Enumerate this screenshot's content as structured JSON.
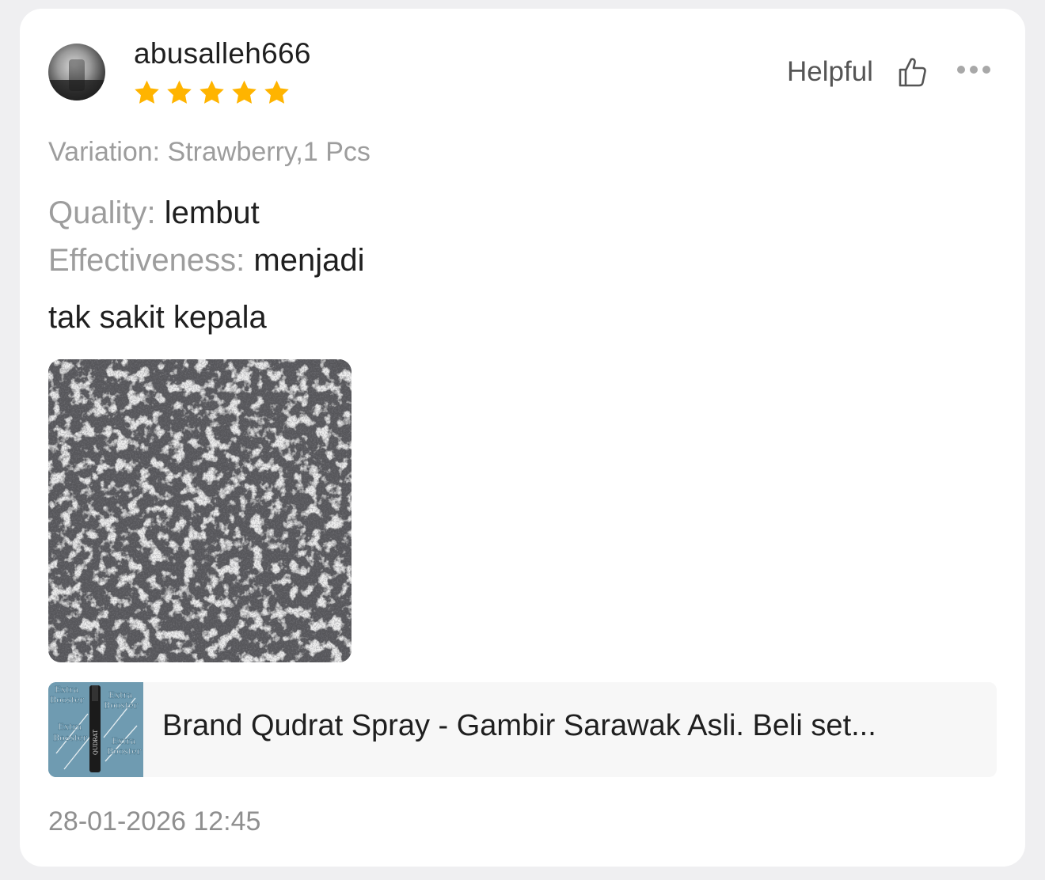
{
  "review": {
    "username": "abusalleh666",
    "rating": 5,
    "rating_max": 5,
    "helpful_label": "Helpful",
    "variation": "Variation: Strawberry,1 Pcs",
    "quality_label": "Quality:",
    "quality_value": "lembut",
    "effectiveness_label": "Effectiveness:",
    "effectiveness_value": "menjadi",
    "comment": "tak sakit kepala",
    "product_title": "Brand Qudrat Spray - Gambir Sarawak Asli. Beli set...",
    "product_thumb_text": [
      "Extra",
      "Booster",
      "Extra",
      "Booster",
      "Extra",
      "Booster",
      "Extra",
      "Booster",
      "QUDRAT"
    ],
    "timestamp": "28-01-2026 12:45"
  },
  "icons": {
    "avatar": "user-avatar",
    "star": "star-icon",
    "thumbs_up": "thumbs-up-icon",
    "more": "more-horizontal-icon"
  },
  "colors": {
    "star": "#FFB400",
    "text_primary": "#1F1F1F",
    "text_secondary": "#9D9D9D",
    "card_background": "#FFFFFF",
    "page_background": "#EFEFF1"
  }
}
